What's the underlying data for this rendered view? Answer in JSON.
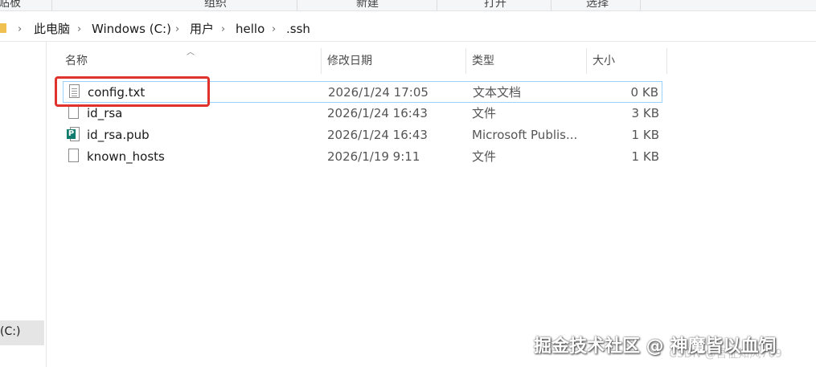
{
  "ribbon": {
    "groups": [
      "贴板",
      "组织",
      "新建",
      "打开",
      "选择"
    ]
  },
  "address": {
    "breadcrumbs": [
      "此电脑",
      "Windows (C:)",
      "用户",
      "hello",
      ".ssh"
    ]
  },
  "columns": {
    "name": "名称",
    "modified": "修改日期",
    "type": "类型",
    "size": "大小"
  },
  "files": [
    {
      "name": "config.txt",
      "modified": "2026/1/24 17:05",
      "type": "文本文档",
      "size": "0 KB",
      "icon": "text-file-icon",
      "selected": true
    },
    {
      "name": "id_rsa",
      "modified": "2026/1/24 16:43",
      "type": "文件",
      "size": "3 KB",
      "icon": "blank-file-icon"
    },
    {
      "name": "id_rsa.pub",
      "modified": "2026/1/24 16:43",
      "type": "Microsoft Publis...",
      "size": "1 KB",
      "icon": "publisher-file-icon"
    },
    {
      "name": "known_hosts",
      "modified": "2026/1/19 9:11",
      "type": "文件",
      "size": "1 KB",
      "icon": "blank-file-icon"
    }
  ],
  "nav": {
    "selected_label": "(C:)"
  },
  "watermark": {
    "primary": "掘金技术社区 @ 神魔皆以血饲",
    "secondary": "CSDN @吾征知风769"
  },
  "colors": {
    "highlight": "#e0322c",
    "selection_border": "#99d1ff",
    "publisher": "#107c6e"
  }
}
